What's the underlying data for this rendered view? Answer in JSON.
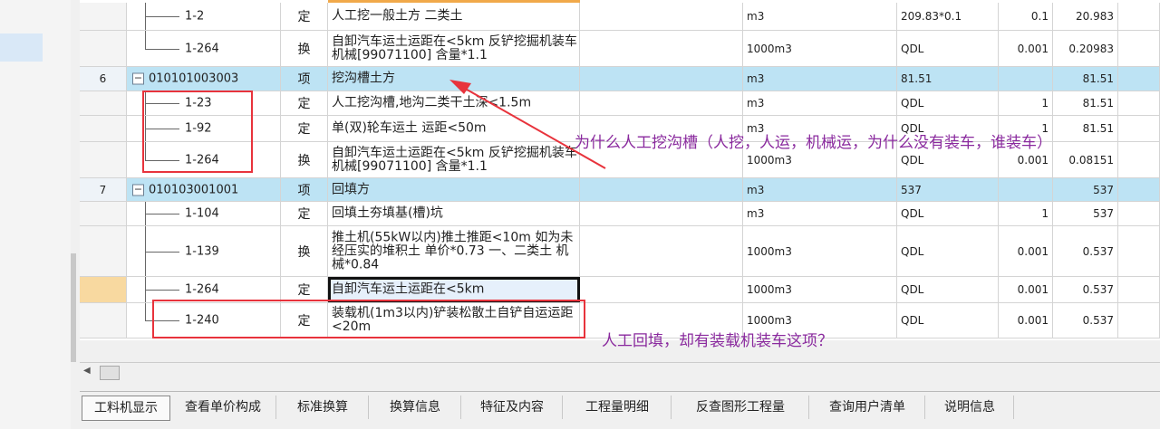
{
  "rows": [
    {
      "kind": "de",
      "idx": "",
      "code": "1-2",
      "type": "定",
      "name": "人工挖一般土方 二类土",
      "unit": "m3",
      "expr": "209.83*0.1",
      "qty": "0.1",
      "total": "20.983"
    },
    {
      "kind": "de",
      "idx": "",
      "code": "1-264",
      "type": "换",
      "name": "自卸汽车运土运距在<5km  反铲挖掘机装车 机械[99071100] 含量*1.1",
      "unit": "1000m3",
      "expr": "QDL",
      "qty": "0.001",
      "total": "0.20983"
    },
    {
      "kind": "qd",
      "idx": "6",
      "code": "010101003003",
      "type": "项",
      "name": "挖沟槽土方",
      "unit": "m3",
      "expr": "81.51",
      "qty": "",
      "total": "81.51"
    },
    {
      "kind": "de",
      "idx": "",
      "code": "1-23",
      "type": "定",
      "name": "人工挖沟槽,地沟二类干土深<1.5m",
      "unit": "m3",
      "expr": "QDL",
      "qty": "1",
      "total": "81.51"
    },
    {
      "kind": "de",
      "idx": "",
      "code": "1-92",
      "type": "定",
      "name": "单(双)轮车运土 运距<50m",
      "unit": "m3",
      "expr": "QDL",
      "qty": "1",
      "total": "81.51"
    },
    {
      "kind": "de",
      "idx": "",
      "code": "1-264",
      "type": "换",
      "name": "自卸汽车运土运距在<5km  反铲挖掘机装车 机械[99071100] 含量*1.1",
      "unit": "1000m3",
      "expr": "QDL",
      "qty": "0.001",
      "total": "0.08151"
    },
    {
      "kind": "qd",
      "idx": "7",
      "code": "010103001001",
      "type": "项",
      "name": "回填方",
      "unit": "m3",
      "expr": "537",
      "qty": "",
      "total": "537"
    },
    {
      "kind": "de",
      "idx": "",
      "code": "1-104",
      "type": "定",
      "name": "回填土夯填基(槽)坑",
      "unit": "m3",
      "expr": "QDL",
      "qty": "1",
      "total": "537"
    },
    {
      "kind": "de",
      "idx": "",
      "code": "1-139",
      "type": "换",
      "name": "推土机(55kW以内)推土推距<10m 如为未经压实的堆积土 单价*0.73 一、二类土 机械*0.84",
      "unit": "1000m3",
      "expr": "QDL",
      "qty": "0.001",
      "total": "0.537"
    },
    {
      "kind": "de",
      "idx": "",
      "code": "1-264",
      "type": "定",
      "name": "自卸汽车运土运距在<5km",
      "unit": "1000m3",
      "expr": "QDL",
      "qty": "0.001",
      "total": "0.537"
    },
    {
      "kind": "de",
      "idx": "",
      "code": "1-240",
      "type": "定",
      "name": "装载机(1m3以内)铲装松散土自铲自运运距<20m",
      "unit": "1000m3",
      "expr": "QDL",
      "qty": "0.001",
      "total": "0.537"
    }
  ],
  "tabs": [
    "工料机显示",
    "查看单价构成",
    "标准换算",
    "换算信息",
    "特征及内容",
    "工程量明细",
    "反查图形工程量",
    "查询用户清单",
    "说明信息"
  ],
  "annotations": {
    "q1": "为什么人工挖沟槽（人挖，人运，机械运，为什么没有装车，谁装车）",
    "q2": "人工回填，却有装载机装车这项？"
  },
  "icons": {
    "expander": "minus-icon",
    "scroll_left": "triangle-left-icon"
  },
  "colors": {
    "annotation_red": "#e8333c",
    "annotation_text": "#8a2a9e",
    "qd_row": "#bde3f4"
  }
}
